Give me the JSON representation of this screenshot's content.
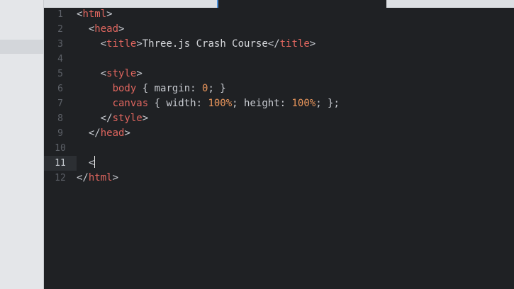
{
  "editor": {
    "lines": [
      {
        "n": "1",
        "indent": "",
        "parts": [
          [
            "punc",
            "<"
          ],
          [
            "tag",
            "html"
          ],
          [
            "punc",
            ">"
          ]
        ]
      },
      {
        "n": "2",
        "indent": "  ",
        "parts": [
          [
            "punc",
            "<"
          ],
          [
            "tag",
            "head"
          ],
          [
            "punc",
            ">"
          ]
        ]
      },
      {
        "n": "3",
        "indent": "    ",
        "parts": [
          [
            "punc",
            "<"
          ],
          [
            "tag",
            "title"
          ],
          [
            "punc",
            ">"
          ],
          [
            "txt",
            "Three.js Crash Course"
          ],
          [
            "punc",
            "</"
          ],
          [
            "tag",
            "title"
          ],
          [
            "punc",
            ">"
          ]
        ]
      },
      {
        "n": "4",
        "indent": "",
        "parts": []
      },
      {
        "n": "5",
        "indent": "    ",
        "parts": [
          [
            "punc",
            "<"
          ],
          [
            "tag",
            "style"
          ],
          [
            "punc",
            ">"
          ]
        ]
      },
      {
        "n": "6",
        "indent": "      ",
        "parts": [
          [
            "prop",
            "body"
          ],
          [
            "punc",
            " { margin: "
          ],
          [
            "num",
            "0"
          ],
          [
            "punc",
            "; }"
          ]
        ]
      },
      {
        "n": "7",
        "indent": "      ",
        "parts": [
          [
            "prop",
            "canvas"
          ],
          [
            "punc",
            " { width: "
          ],
          [
            "num",
            "100%"
          ],
          [
            "punc",
            "; height: "
          ],
          [
            "num",
            "100%"
          ],
          [
            "punc",
            "; };"
          ]
        ]
      },
      {
        "n": "8",
        "indent": "    ",
        "parts": [
          [
            "punc",
            "</"
          ],
          [
            "tag",
            "style"
          ],
          [
            "punc",
            ">"
          ]
        ]
      },
      {
        "n": "9",
        "indent": "  ",
        "parts": [
          [
            "punc",
            "</"
          ],
          [
            "tag",
            "head"
          ],
          [
            "punc",
            ">"
          ]
        ]
      },
      {
        "n": "10",
        "indent": "",
        "parts": []
      },
      {
        "n": "11",
        "indent": "  ",
        "parts": [
          [
            "punc",
            "<"
          ]
        ],
        "current": true
      },
      {
        "n": "12",
        "indent": "",
        "parts": [
          [
            "punc",
            "</"
          ],
          [
            "tag",
            "html"
          ],
          [
            "punc",
            ">"
          ]
        ]
      }
    ]
  },
  "colors": {
    "tag": "#e0665f",
    "number": "#e9955b",
    "text": "#c9ccd2",
    "background": "#1f2124",
    "sidebar": "#e4e6e9",
    "cursor": "#e8e8e8"
  }
}
